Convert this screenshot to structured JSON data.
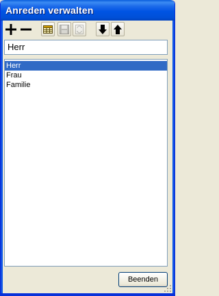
{
  "window": {
    "title": "Anreden verwalten"
  },
  "toolbar": {
    "buttons": [
      {
        "icon": "add-icon",
        "enabled": true
      },
      {
        "icon": "remove-icon",
        "enabled": true
      },
      {
        "icon": "table-icon",
        "enabled": true
      },
      {
        "icon": "save-icon",
        "enabled": false
      },
      {
        "icon": "refresh-icon",
        "enabled": false
      },
      {
        "icon": "arrow-down-icon",
        "enabled": true
      },
      {
        "icon": "arrow-up-icon",
        "enabled": true
      }
    ]
  },
  "edit": {
    "value": "Herr"
  },
  "list": {
    "items": [
      "Herr",
      "Frau",
      "Familie"
    ],
    "selected_index": 0
  },
  "footer": {
    "close_label": "Beenden"
  },
  "colors": {
    "title_bar": "#0054e3",
    "selection": "#316ac5",
    "face": "#ece9d8"
  }
}
